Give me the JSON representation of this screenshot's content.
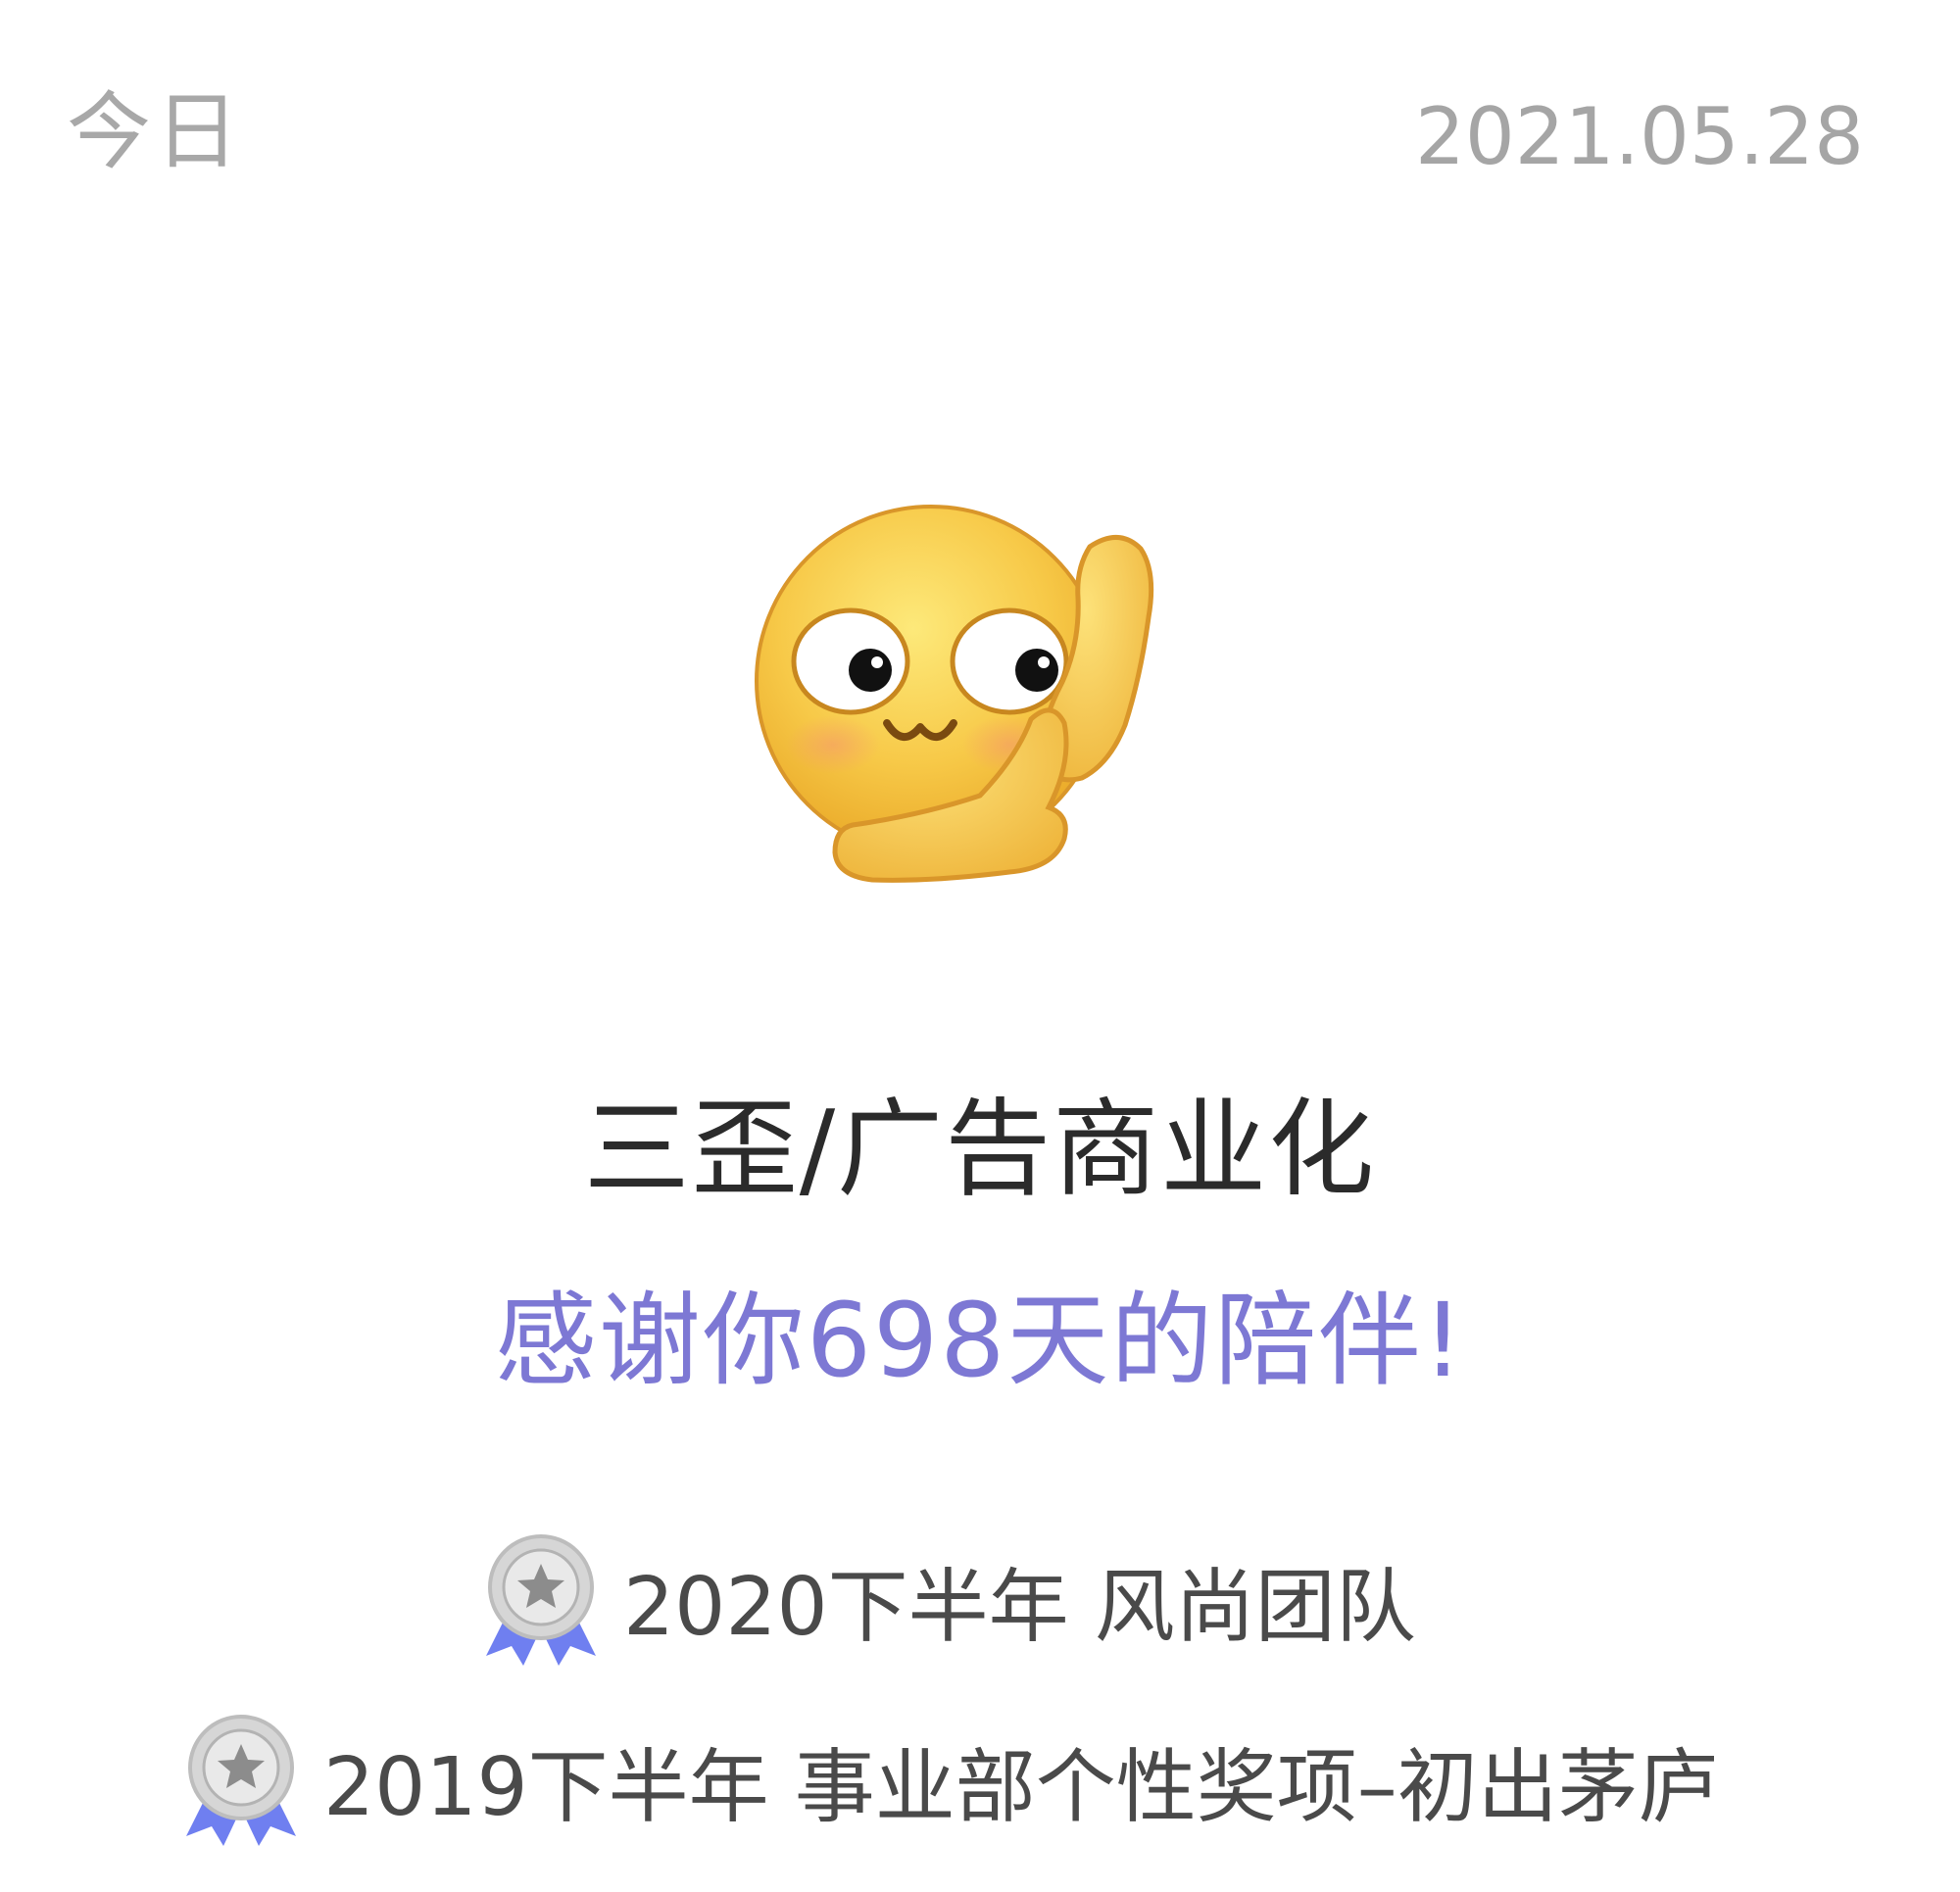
{
  "header": {
    "label": "今日",
    "date": "2021.05.28"
  },
  "profile": {
    "avatar_icon": "waving-smiley-emoji-icon",
    "team_name": "三歪/广告商业化",
    "thanks_message": "感谢你698天的陪伴!"
  },
  "awards": [
    {
      "icon": "silver-medal-icon",
      "text": "2020下半年 风尚团队"
    },
    {
      "icon": "silver-medal-icon",
      "text": "2019下半年 事业部个性奖项–初出茅庐"
    }
  ],
  "colors": {
    "header_text": "#a8a8a8",
    "team_name": "#2b2b2b",
    "thanks_accent": "#7d78d4",
    "award_text": "#4a4a4a",
    "medal_ribbon": "#6f7ff0",
    "emoji_yellow": "#f7c948"
  }
}
